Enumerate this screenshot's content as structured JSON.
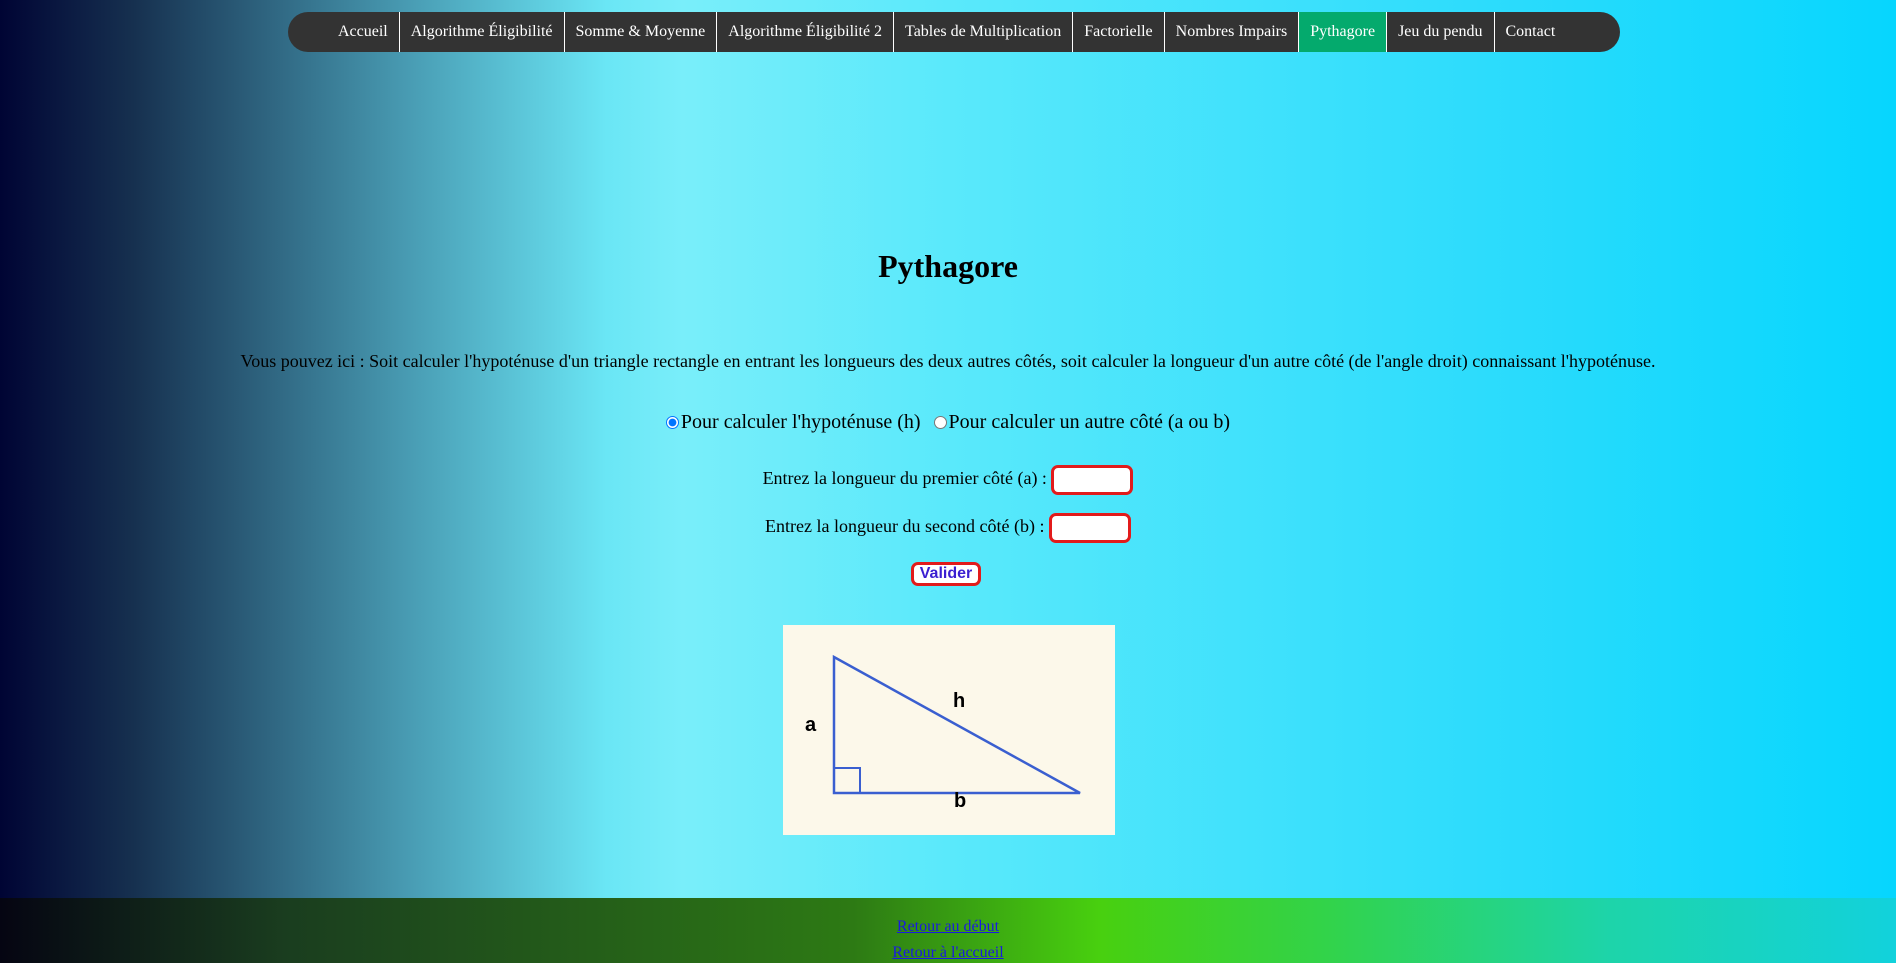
{
  "nav": {
    "items": [
      {
        "label": "Accueil",
        "active": false
      },
      {
        "label": "Algorithme Éligibilité",
        "active": false
      },
      {
        "label": "Somme & Moyenne",
        "active": false
      },
      {
        "label": "Algorithme Éligibilité 2",
        "active": false
      },
      {
        "label": "Tables de Multiplication",
        "active": false
      },
      {
        "label": "Factorielle",
        "active": false
      },
      {
        "label": "Nombres Impairs",
        "active": false
      },
      {
        "label": "Pythagore",
        "active": true
      },
      {
        "label": "Jeu du pendu",
        "active": false
      },
      {
        "label": "Contact",
        "active": false
      }
    ],
    "active_color": "#04aa6d"
  },
  "page": {
    "title": "Pythagore",
    "intro": "Vous pouvez ici : Soit calculer l'hypoténuse d'un triangle rectangle en entrant les longueurs des deux autres côtés, soit calculer la longueur d'un autre côté (de l'angle droit) connaissant l'hypoténuse."
  },
  "mode": {
    "option_h": "Pour calculer l'hypoténuse (h)",
    "option_ab": "Pour calculer un autre côté (a ou b)",
    "selected": "h"
  },
  "form": {
    "label_a": "Entrez la longueur du premier côté (a) :",
    "value_a": "",
    "label_b": "Entrez la longueur du second côté (b) :",
    "value_b": "",
    "submit": "Valider",
    "accent_color": "#e21b1b"
  },
  "figure": {
    "label_a": "a",
    "label_b": "b",
    "label_h": "h",
    "line_color": "#3a5fd0"
  },
  "footer": {
    "top_link": "Retour au début",
    "home_link": "Retour à l'accueil"
  }
}
